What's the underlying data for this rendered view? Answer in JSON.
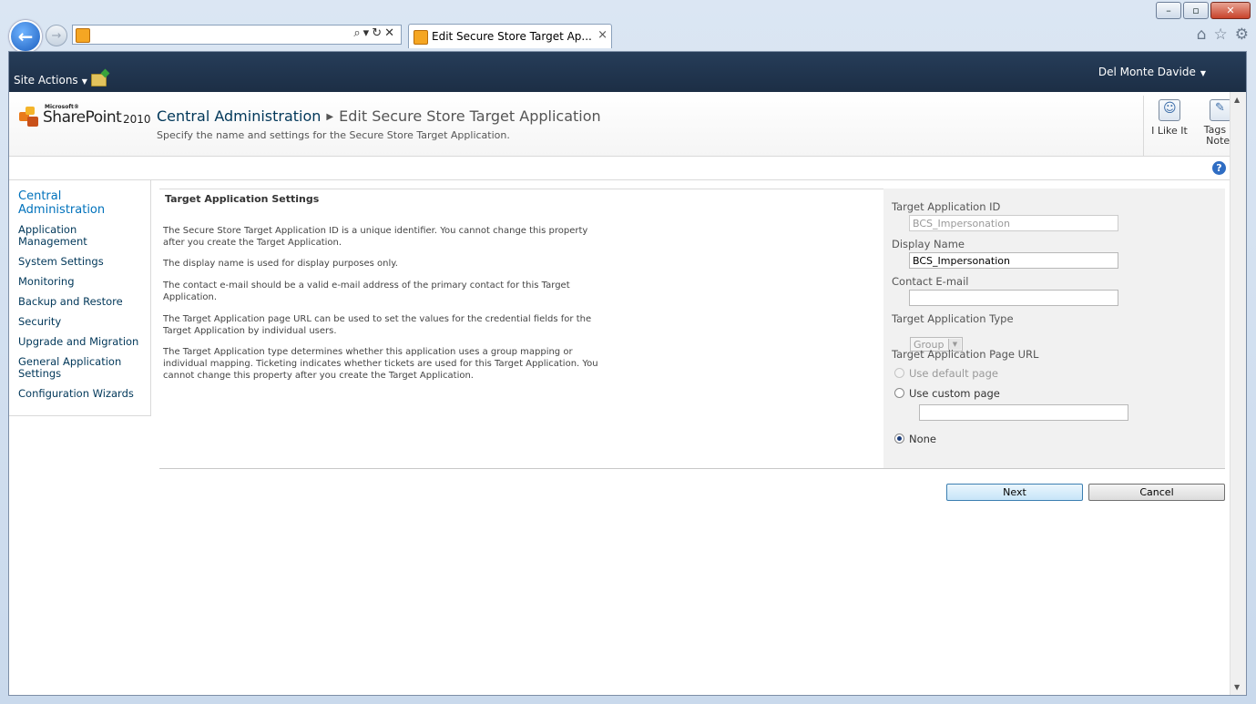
{
  "browser": {
    "tab_title": "Edit Secure Store Target Ap...",
    "address_value": "",
    "tab_close": "×",
    "address_tools": "⌕▾↻✕"
  },
  "ribbon": {
    "site_actions": "Site Actions",
    "user_name": "Del Monte Davide"
  },
  "header": {
    "logo_ms": "Microsoft®",
    "logo_name": "SharePoint",
    "logo_year": "2010",
    "breadcrumb_root": "Central Administration",
    "breadcrumb_current": "Edit Secure Store Target Application",
    "description": "Specify the name and settings for the Secure Store Target Application.",
    "like_label": "I Like It",
    "tags_label_1": "Tags &",
    "tags_label_2": "Notes"
  },
  "leftnav": {
    "heading": "Central Administration",
    "items": [
      "Application Management",
      "System Settings",
      "Monitoring",
      "Backup and Restore",
      "Security",
      "Upgrade and Migration",
      "General Application Settings",
      "Configuration Wizards"
    ]
  },
  "section": {
    "title": "Target Application Settings",
    "paragraphs": [
      "The Secure Store Target Application ID is a unique identifier. You cannot change this property after you create the Target Application.",
      "The display name is used for display purposes only.",
      "The contact e-mail should be a valid e-mail address of the primary contact for this Target Application.",
      "The Target Application page URL can be used to set the values for the credential fields for the Target Application by individual users.",
      "The Target Application type determines whether this application uses a group mapping or individual mapping. Ticketing indicates whether tickets are used for this Target Application. You cannot change this property after you create the Target Application."
    ]
  },
  "form": {
    "app_id_label": "Target Application ID",
    "app_id_value": "BCS_Impersonation",
    "display_name_label": "Display Name",
    "display_name_value": "BCS_Impersonation",
    "contact_label": "Contact E-mail",
    "contact_value": "",
    "type_label": "Target Application Type",
    "type_value": "Group",
    "page_url_label": "Target Application Page URL",
    "opt_default": "Use default page",
    "opt_custom": "Use custom page",
    "custom_url_value": "",
    "opt_none": "None",
    "selected_option": "None"
  },
  "buttons": {
    "next": "Next",
    "cancel": "Cancel"
  },
  "help": "?"
}
